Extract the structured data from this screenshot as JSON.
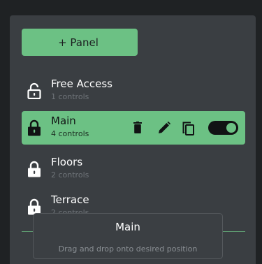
{
  "add_button": {
    "label": "+ Panel"
  },
  "panels": [
    {
      "title": "Free Access",
      "subtitle": "1 controls",
      "lock": "unlock-icon",
      "active": false
    },
    {
      "title": "Main",
      "subtitle": "4 controls",
      "lock": "lock-icon",
      "active": true
    },
    {
      "title": "Floors",
      "subtitle": "2 controls",
      "lock": "lock-icon",
      "active": false
    },
    {
      "title": "Terrace",
      "subtitle": "2 controls",
      "lock": "lock-icon",
      "active": false
    }
  ],
  "active_actions": {
    "icons": [
      "trash-icon",
      "pencil-icon",
      "copy-icon"
    ],
    "toggle_on": true
  },
  "tooltip": {
    "title": "Main",
    "hint": "Drag and drop onto desired position"
  },
  "colors": {
    "accent": "#6cc184",
    "panel_bg": "#3a3e42",
    "page_bg": "#1f2224"
  }
}
